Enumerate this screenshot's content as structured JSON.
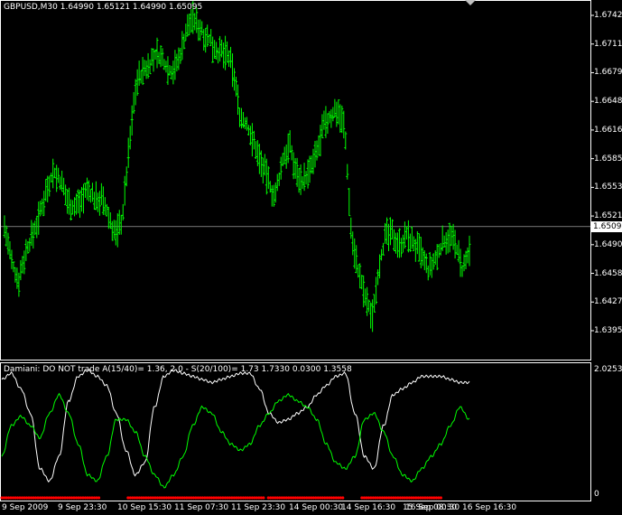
{
  "main_chart": {
    "title": "GBPUSD,M30  1.64990 1.65121 1.64990 1.65095",
    "bid_price": "1.65095",
    "bid_value": 1.65095,
    "colors": {
      "background": "#000000",
      "bars": "#00ff00",
      "axis": "#ffffff",
      "bid_line": "#c0c0c0"
    },
    "price_scale": {
      "min": 1.6395,
      "max": 1.6742,
      "labels": [
        "1.67420",
        "1.67110",
        "1.66790",
        "1.66480",
        "1.66160",
        "1.65850",
        "1.65530",
        "1.65210",
        "1.64900",
        "1.64580",
        "1.64270",
        "1.63950"
      ]
    },
    "bars": [
      1.651,
      1.647,
      1.645,
      1.648,
      1.65,
      1.652,
      1.655,
      1.657,
      1.656,
      1.654,
      1.653,
      1.654,
      1.655,
      1.654,
      1.654,
      1.652,
      1.65,
      1.652,
      1.66,
      1.667,
      1.668,
      1.669,
      1.67,
      1.669,
      1.668,
      1.669,
      1.672,
      1.674,
      1.673,
      1.672,
      1.671,
      1.67,
      1.67,
      1.668,
      1.663,
      1.662,
      1.66,
      1.658,
      1.656,
      1.654,
      1.658,
      1.66,
      1.657,
      1.656,
      1.657,
      1.659,
      1.662,
      1.663,
      1.664,
      1.662,
      1.65,
      1.646,
      1.643,
      1.641,
      1.647,
      1.65,
      1.65,
      1.649,
      1.65,
      1.649,
      1.648,
      1.646,
      1.647,
      1.649,
      1.65,
      1.649,
      1.646,
      1.648
    ]
  },
  "indicator": {
    "caption": "Damiani: DO NOT trade A(15/40)= 1.36, 2.0 - S(20/100)= 1.73  1.7330 0.0300 1.3558",
    "scale": {
      "max_label": "2.0253",
      "min_label": "0",
      "max": 2.0253,
      "min": 0
    },
    "colors": {
      "white_line": "#ffffff",
      "green_line": "#00ff00",
      "red_band": "#ff0000"
    },
    "white_line": [
      1.85,
      1.95,
      1.7,
      1.3,
      0.4,
      0.2,
      0.6,
      1.5,
      1.9,
      2.0,
      1.9,
      1.75,
      1.3,
      0.7,
      0.3,
      0.5,
      1.4,
      1.9,
      2.0,
      1.95,
      1.9,
      1.85,
      1.8,
      1.85,
      1.9,
      1.95,
      1.95,
      1.7,
      1.3,
      1.15,
      1.2,
      1.3,
      1.4,
      1.6,
      1.75,
      1.9,
      1.95,
      1.3,
      0.6,
      0.4,
      1.1,
      1.6,
      1.7,
      1.8,
      1.9,
      1.9,
      1.9,
      1.85,
      1.8,
      1.8
    ],
    "green_line": [
      0.6,
      1.1,
      1.25,
      1.1,
      0.9,
      1.3,
      1.6,
      1.3,
      0.8,
      0.3,
      0.2,
      0.6,
      1.2,
      1.2,
      1.0,
      0.6,
      0.3,
      0.1,
      0.3,
      0.6,
      1.1,
      1.4,
      1.3,
      1.0,
      0.8,
      0.7,
      0.8,
      1.1,
      1.3,
      1.5,
      1.6,
      1.5,
      1.4,
      1.2,
      0.8,
      0.5,
      0.4,
      0.6,
      1.2,
      1.3,
      1.0,
      0.6,
      0.3,
      0.2,
      0.4,
      0.6,
      0.8,
      1.1,
      1.4,
      1.2
    ],
    "red_band_segments": [
      [
        0,
        0.21
      ],
      [
        0.27,
        0.56
      ],
      [
        0.57,
        0.73
      ],
      [
        0.77,
        0.94
      ]
    ]
  },
  "time_axis": {
    "labels": [
      "9 Sep 2009",
      "9 Sep 23:30",
      "10 Sep 15:30",
      "11 Sep 07:30",
      "11 Sep 23:30",
      "14 Sep 00:30",
      "14 Sep 16:30",
      "15 Sep 08:30",
      "16 Sep 00:30",
      "16 Sep 16:30"
    ]
  },
  "icons": {
    "scroll_marker": "triangle-down-icon"
  }
}
